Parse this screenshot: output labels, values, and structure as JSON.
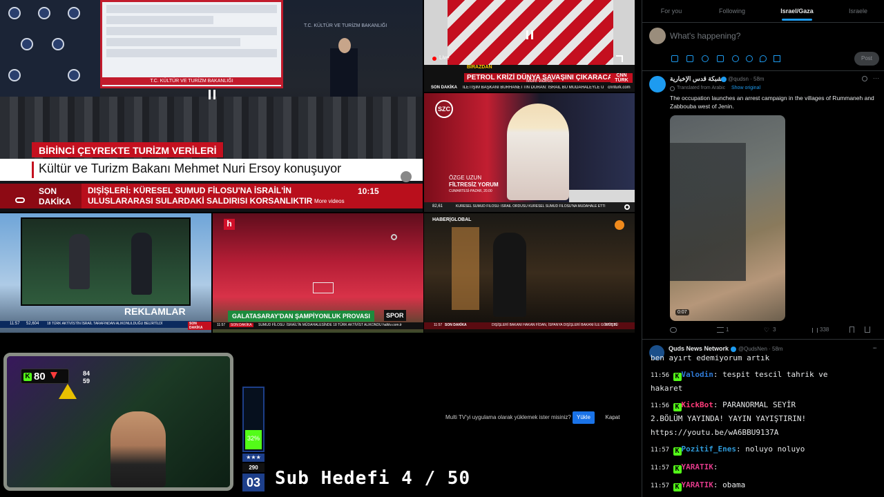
{
  "ministry": {
    "screen_title": "T.C. KÜLTÜR VE TURİZM BAKANLIĞI",
    "wall_brand": "T.C. KÜLTÜR VE TURİZM BAKANLIĞI",
    "headline_top": "BİRİNCİ ÇEYREKTE TURİZM VERİLERİ",
    "headline_main": "Kültür ve Turizm Bakanı Mehmet Nuri Ersoy konuşuyor",
    "ticker_label_1": "SON",
    "ticker_label_2": "DAKİKA",
    "ticker_text": "DIŞİŞLERİ: KÜRESEL SUMUD FİLOSU'NA İSRAİL'İN ULUSLARARASI SULARDAKİ SALDIRISI KORSANLIKTIR",
    "time": "10:15",
    "more_videos": "More videos",
    "pause_icon": "pause-icon"
  },
  "cnn": {
    "live": "Live",
    "top_tag": "BİRAZDAN",
    "headline": "PETROL KRİZİ DÜNYA SAVAŞINI ÇIKARACAK?",
    "more_videos": "More videos",
    "brand": "CNN TÜRK",
    "ticker_label": "SON DAKİKA",
    "ticker_text": "İLETİŞİM BAŞKANI BURHANETTİN DURAN: İSRAİL BU MÜDAHALEYLE ULUSLAR",
    "site": "cnnturk.com"
  },
  "szc": {
    "brand": "SZC",
    "presenter": "ÖZGE UZUN",
    "program": "FİLTRESİZ YORUM",
    "schedule": "CUMARTESİ-PAZAR, 20.00",
    "ticker": "KÜRESEL SUMUD FİLOSU: İSRAİL ORDUSU KÜRESEL SUMUD FİLOSU'NA MÜDAHALE ETTİ",
    "ticker_prefix": "82,61"
  },
  "ad": {
    "label": "REKLAMLAR",
    "ticker_time": "11:57",
    "ticker_value": "52,604",
    "ticker_text": "18 TÜRK AKTİVİSTİN İSRAİL TARAFINDAN ALIKONULDUĞU BELİRTİLDİ",
    "ticker_tag": "SON DAKİKA"
  },
  "halk": {
    "logo": "h",
    "headline": "GALATASARAY'DAN ŞAMPİYONLUK PROVASI",
    "tag": "SPOR",
    "ticker_time": "11:57",
    "ticker_tag": "SON DAKİKA",
    "ticker_text": "SUMUD FİLOSU: İSRAİL'İN MÜDAHALESİNDE 18 TÜRK AKTİVİST ALIKONDU",
    "site": "halktv.com.tr"
  },
  "haber": {
    "brand": "HABER|GLOBAL",
    "ticker_time": "11:57",
    "ticker_tag": "SON DAKİKA",
    "ticker_text": "DIŞİŞLERİ BAKANI HAKAN FİDAN, İSPANYA DIŞİŞLERİ BAKANI İLE GÖRÜŞTÜ",
    "ticker_value": "6707,91"
  },
  "install": {
    "prompt": "Multi TV'yi uygulama olarak yüklemek ister misiniz?",
    "install_label": "Yükle",
    "close_label": "Kapat"
  },
  "streamer": {
    "kick_count": "80",
    "side_top": "84",
    "side_bottom": "59",
    "goal_percent": "32%",
    "goal_fraction": 0.32,
    "count_box": "290",
    "subs_box": "03",
    "sub_goal": "Sub Hedefi 4 / 50",
    "accent": "#53fc18"
  },
  "x": {
    "tabs": [
      "For you",
      "Following",
      "Israel/Gaza",
      "Israele"
    ],
    "compose_placeholder": "What's happening?",
    "post_label": "Post",
    "tweet1": {
      "name": "شبكة قدس الإخبارية",
      "handle": "@qudsn · 58m",
      "translated_prefix": "Translated from Arabic",
      "show_original": "Show original",
      "text": "The occupation launches an arrest campaign in the villages of Rummaneh and Zabbouba west of Jenin.",
      "video_time": "0:07",
      "replies": "",
      "reposts": "1",
      "likes": "3",
      "views": "338"
    },
    "tweet2": {
      "name": "Quds News Network",
      "handle": "@QudsNen · 58m"
    },
    "brand_color": "#1d9bf0"
  },
  "chat": {
    "lines": [
      {
        "time": "",
        "user": "",
        "text": "ben ayırt edemiyorum artık"
      },
      {
        "time": "11:56",
        "user": "Valodin",
        "text": ": tespit tescil tahrik ve"
      },
      {
        "time": "",
        "user": "",
        "text": "hakaret"
      },
      {
        "time": "11:56",
        "user": "KickBot",
        "text": ": PARANORMAL SEYİR"
      },
      {
        "time": "",
        "user": "",
        "text": "2.BÖLÜM YAYINDA! YAYIN YAYIŞTIRIN!"
      },
      {
        "time": "",
        "user": "",
        "text": "https://youtu.be/wA6BBU9137A"
      },
      {
        "time": "11:57",
        "user": "Pozitif_Enes",
        "text": ": noluyo noluyo"
      },
      {
        "time": "11:57",
        "user": "YARATIK",
        "text": ":"
      },
      {
        "time": "11:57",
        "user": "YARATIK",
        "text": ": obama"
      }
    ],
    "user_colors": {
      "Valodin": "#2f7bd8",
      "KickBot": "#ff3b7a",
      "Pozitif_Enes": "#2f9ad8",
      "YARATIK": "#e03a8a"
    }
  }
}
